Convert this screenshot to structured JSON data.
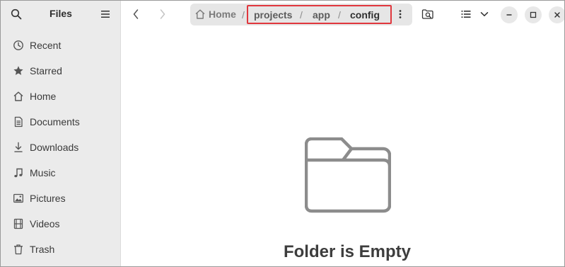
{
  "app": {
    "title": "Files"
  },
  "sidebar": {
    "items": [
      {
        "label": "Recent",
        "icon": "clock-icon"
      },
      {
        "label": "Starred",
        "icon": "star-icon"
      },
      {
        "label": "Home",
        "icon": "home-icon"
      },
      {
        "label": "Documents",
        "icon": "document-icon"
      },
      {
        "label": "Downloads",
        "icon": "download-icon"
      },
      {
        "label": "Music",
        "icon": "music-note-icon"
      },
      {
        "label": "Pictures",
        "icon": "picture-icon"
      },
      {
        "label": "Videos",
        "icon": "film-icon"
      },
      {
        "label": "Trash",
        "icon": "trash-icon"
      }
    ]
  },
  "pathbar": {
    "home": "Home",
    "segments": [
      "projects",
      "app",
      "config"
    ],
    "separator": "/",
    "highlight_color": "#e0373d"
  },
  "content": {
    "empty_title": "Folder is Empty"
  }
}
